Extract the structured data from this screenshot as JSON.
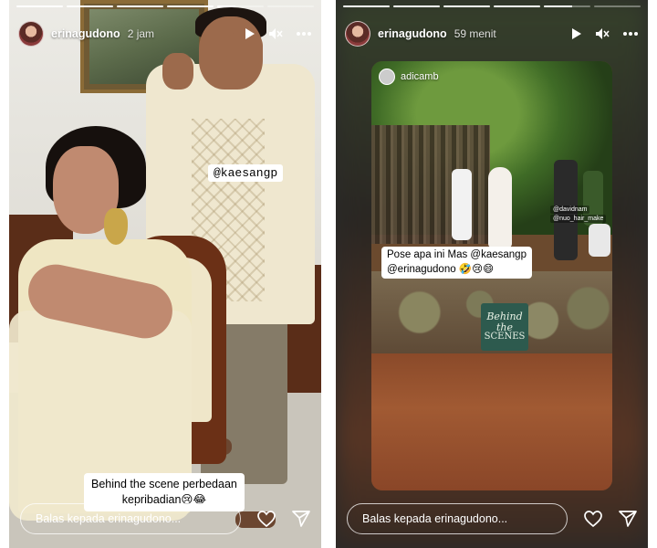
{
  "stories": [
    {
      "username": "erinagudono",
      "time": "2 jam",
      "progress": [
        1,
        1,
        1,
        1,
        0.4,
        0
      ],
      "mention": "@kaesangp",
      "caption_line1": "Behind the scene perbedaan",
      "caption_line2": "kepribadian😢😂",
      "reply_placeholder": "Balas kepada erinagudono..."
    },
    {
      "username": "erinagudono",
      "time": "59 menit",
      "progress": [
        1,
        1,
        1,
        1,
        0.6,
        0
      ],
      "photo_user": "adicamb",
      "caption_line1": "Pose apa ini Mas @kaesangp",
      "caption_line2": "@erinagudono 🤣😢😄",
      "sticker_line1": "Behind",
      "sticker_line2": "the",
      "sticker_line3": "SCENES",
      "tag1": "@davidnam",
      "tag2": "@nuo_hair_make",
      "reply_placeholder": "Balas kepada erinagudono..."
    }
  ],
  "icons": [
    "play-icon",
    "mute-icon",
    "more-icon",
    "heart-icon",
    "send-icon"
  ]
}
